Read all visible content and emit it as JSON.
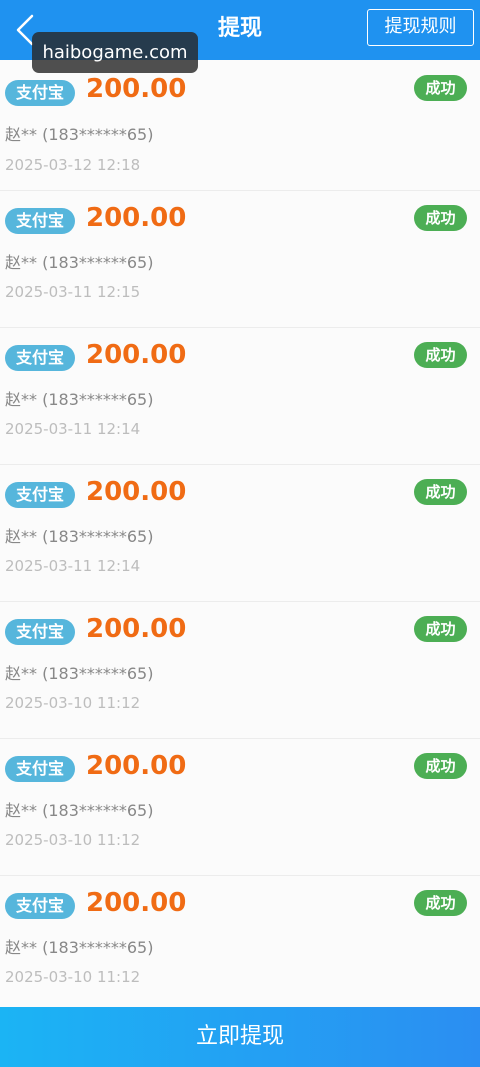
{
  "header": {
    "title": "提现",
    "rules_label": "提现规则",
    "back_icon": "chevron-left-icon"
  },
  "watermark": {
    "text": "haibogame.com"
  },
  "records": [
    {
      "channel": "支付宝",
      "amount": "200.00",
      "status": "成功",
      "account": "赵** (183******65)",
      "time": "2025-03-12 12:18"
    },
    {
      "channel": "支付宝",
      "amount": "200.00",
      "status": "成功",
      "account": "赵** (183******65)",
      "time": "2025-03-11 12:15"
    },
    {
      "channel": "支付宝",
      "amount": "200.00",
      "status": "成功",
      "account": "赵** (183******65)",
      "time": "2025-03-11 12:14"
    },
    {
      "channel": "支付宝",
      "amount": "200.00",
      "status": "成功",
      "account": "赵** (183******65)",
      "time": "2025-03-11 12:14"
    },
    {
      "channel": "支付宝",
      "amount": "200.00",
      "status": "成功",
      "account": "赵** (183******65)",
      "time": "2025-03-10 11:12"
    },
    {
      "channel": "支付宝",
      "amount": "200.00",
      "status": "成功",
      "account": "赵** (183******65)",
      "time": "2025-03-10 11:12"
    },
    {
      "channel": "支付宝",
      "amount": "200.00",
      "status": "成功",
      "account": "赵** (183******65)",
      "time": "2025-03-10 11:12"
    }
  ],
  "footer": {
    "withdraw_label": "立即提现"
  },
  "colors": {
    "header_bg": "#1f92f0",
    "amount": "#f06b14",
    "channel_badge": "#56b6dc",
    "status_success": "#4cae54"
  }
}
